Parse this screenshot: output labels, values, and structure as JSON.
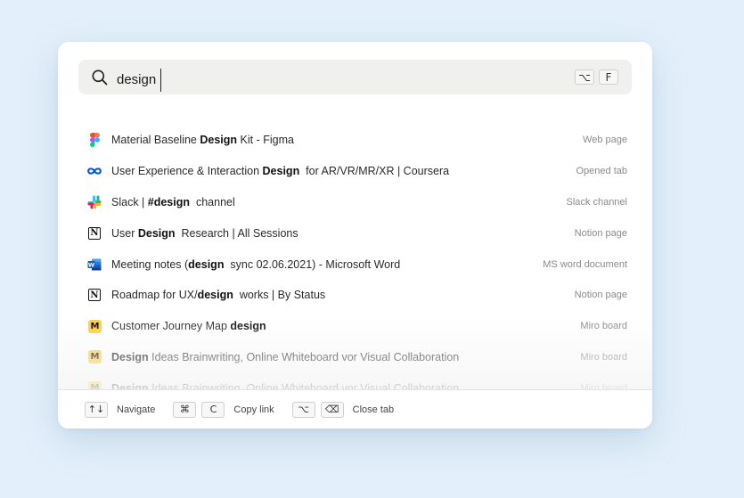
{
  "search": {
    "query": "design",
    "shortcut_keys": [
      "⌥",
      "F"
    ]
  },
  "results": [
    {
      "icon": "figma-icon",
      "parts": [
        [
          "Material Baseline ",
          false
        ],
        [
          "Design",
          true
        ],
        [
          " Kit - Figma",
          false
        ]
      ],
      "type": "Web page"
    },
    {
      "icon": "coursera-icon",
      "parts": [
        [
          "User Experience & Interaction ",
          false
        ],
        [
          "Design",
          true
        ],
        [
          "  for AR/VR/MR/XR | Coursera",
          false
        ]
      ],
      "type": "Opened tab"
    },
    {
      "icon": "slack-icon",
      "parts": [
        [
          "Slack | ",
          false
        ],
        [
          "#design",
          true
        ],
        [
          "  channel",
          false
        ]
      ],
      "type": "Slack channel"
    },
    {
      "icon": "notion-icon",
      "parts": [
        [
          "User ",
          false
        ],
        [
          "Design",
          true
        ],
        [
          "  Research | All Sessions",
          false
        ]
      ],
      "type": "Notion page"
    },
    {
      "icon": "word-icon",
      "parts": [
        [
          "Meeting notes (",
          false
        ],
        [
          "design",
          true
        ],
        [
          "  sync 02.06.2021) - Microsoft Word",
          false
        ]
      ],
      "type": "MS word document"
    },
    {
      "icon": "notion-icon",
      "parts": [
        [
          "Roadmap for UX/",
          false
        ],
        [
          "design",
          true
        ],
        [
          "  works | By Status",
          false
        ]
      ],
      "type": "Notion page"
    },
    {
      "icon": "miro-icon",
      "parts": [
        [
          "Customer Journey Map ",
          false
        ],
        [
          "design",
          true
        ]
      ],
      "type": "Miro board"
    },
    {
      "icon": "miro-icon",
      "parts": [
        [
          "Design",
          true
        ],
        [
          " Ideas Brainwriting, Online Whiteboard vor Visual Collaboration",
          false
        ]
      ],
      "type": "Miro board"
    },
    {
      "icon": "miro-icon",
      "parts": [
        [
          "Design",
          true
        ],
        [
          " Ideas Brainwriting, Online Whiteboard vor Visual Collaboration",
          false
        ]
      ],
      "type": "Miro board"
    }
  ],
  "footer": {
    "navigate": {
      "keys": [
        "↑↓"
      ],
      "label": "Navigate"
    },
    "copy": {
      "keys": [
        "⌘",
        "C"
      ],
      "label": "Copy link"
    },
    "close": {
      "keys": [
        "⌥",
        "⌫"
      ],
      "label": "Close tab"
    }
  },
  "colors": {
    "background": "#e3f0fb",
    "panel": "#ffffff",
    "search_bg": "#f0f0ef",
    "miro_yellow": "#ffd02f",
    "coursera_blue": "#0056d2",
    "word_blue": "#2b7cd3"
  }
}
